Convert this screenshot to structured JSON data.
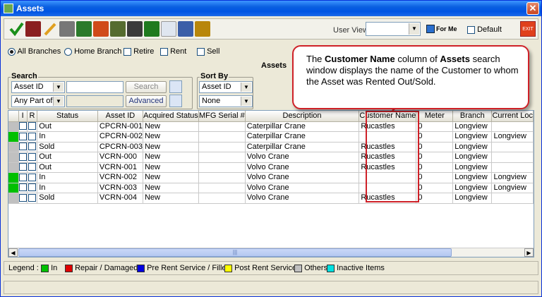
{
  "window": {
    "title": "Assets",
    "close": "✕"
  },
  "toolbar": {
    "icons": [
      "check-icon",
      "calculator-icon",
      "pencil-icon",
      "document-icon",
      "asset-icon",
      "shapes-icon",
      "transfer-icon",
      "warehouse-icon",
      "green-box-icon",
      "user-icon",
      "report-icon",
      "tools-icon"
    ],
    "user_view_label": "User View",
    "user_view_value": "",
    "for_me_label": "For Me",
    "default_label": "Default",
    "exit_label": "EXIT"
  },
  "filters": {
    "branch_options": [
      "All Branches",
      "Home Branch"
    ],
    "selected_branch": "All Branches",
    "checks": [
      "Retire",
      "Rent",
      "Sell"
    ]
  },
  "section_title": "Assets",
  "search": {
    "legend": "Search",
    "field": "Asset ID",
    "match": "Any Part of ...",
    "text": "",
    "search_label": "Search",
    "advanced_label": "Advanced"
  },
  "sort": {
    "legend": "Sort By",
    "field": "Asset ID",
    "order": "None"
  },
  "table": {
    "columns": [
      "",
      "I",
      "R",
      "Status",
      "Asset ID",
      "Acquired Status",
      "MFG Serial #",
      "Description",
      "Customer Name",
      "Meter",
      "Branch",
      "Current Loc"
    ],
    "rows": [
      {
        "color": "#c0c0c0",
        "status": "Out",
        "asset_id": "CPCRN-001",
        "acquired": "New",
        "serial": "",
        "description": "Caterpillar Crane",
        "customer": "Rucastles",
        "meter": "0",
        "branch": "Longview",
        "location": ""
      },
      {
        "color": "#00c000",
        "status": "In",
        "asset_id": "CPCRN-002",
        "acquired": "New",
        "serial": "",
        "description": "Caterpillar Crane",
        "customer": "",
        "meter": "0",
        "branch": "Longview",
        "location": "Longview"
      },
      {
        "color": "#c0c0c0",
        "status": "Sold",
        "asset_id": "CPCRN-003",
        "acquired": "New",
        "serial": "",
        "description": "Caterpillar Crane",
        "customer": "Rucastles",
        "meter": "0",
        "branch": "Longview",
        "location": ""
      },
      {
        "color": "#c0c0c0",
        "status": "Out",
        "asset_id": "VCRN-000",
        "acquired": "New",
        "serial": "",
        "description": "Volvo Crane",
        "customer": "Rucastles",
        "meter": "0",
        "branch": "Longview",
        "location": ""
      },
      {
        "color": "#c0c0c0",
        "status": "Out",
        "asset_id": "VCRN-001",
        "acquired": "New",
        "serial": "",
        "description": "Volvo Crane",
        "customer": "Rucastles",
        "meter": "0",
        "branch": "Longview",
        "location": ""
      },
      {
        "color": "#00c000",
        "status": "In",
        "asset_id": "VCRN-002",
        "acquired": "New",
        "serial": "",
        "description": "Volvo Crane",
        "customer": "",
        "meter": "0",
        "branch": "Longview",
        "location": "Longview"
      },
      {
        "color": "#00c000",
        "status": "In",
        "asset_id": "VCRN-003",
        "acquired": "New",
        "serial": "",
        "description": "Volvo Crane",
        "customer": "",
        "meter": "0",
        "branch": "Longview",
        "location": "Longview"
      },
      {
        "color": "#c0c0c0",
        "status": "Sold",
        "asset_id": "VCRN-004",
        "acquired": "New",
        "serial": "",
        "description": "Volvo Crane",
        "customer": "Rucastles",
        "meter": "0",
        "branch": "Longview",
        "location": ""
      }
    ]
  },
  "legend": {
    "label": "Legend :",
    "items": [
      {
        "color": "#00c000",
        "label": "In"
      },
      {
        "color": "#e00000",
        "label": "Repair / Damaged"
      },
      {
        "color": "#0000e0",
        "label": "Pre Rent Service / Filled"
      },
      {
        "color": "#ffff00",
        "label": "Post Rent Service"
      },
      {
        "color": "#c0c0c0",
        "label": "Others"
      },
      {
        "color": "#00e0e0",
        "label": "Inactive Items"
      }
    ]
  },
  "callout": {
    "pre": "The ",
    "bold1": "Customer Name",
    "mid": " column of ",
    "bold2": "Assets",
    "post": " search window displays the name of the Customer to whom the Asset was Rented Out/Sold."
  }
}
